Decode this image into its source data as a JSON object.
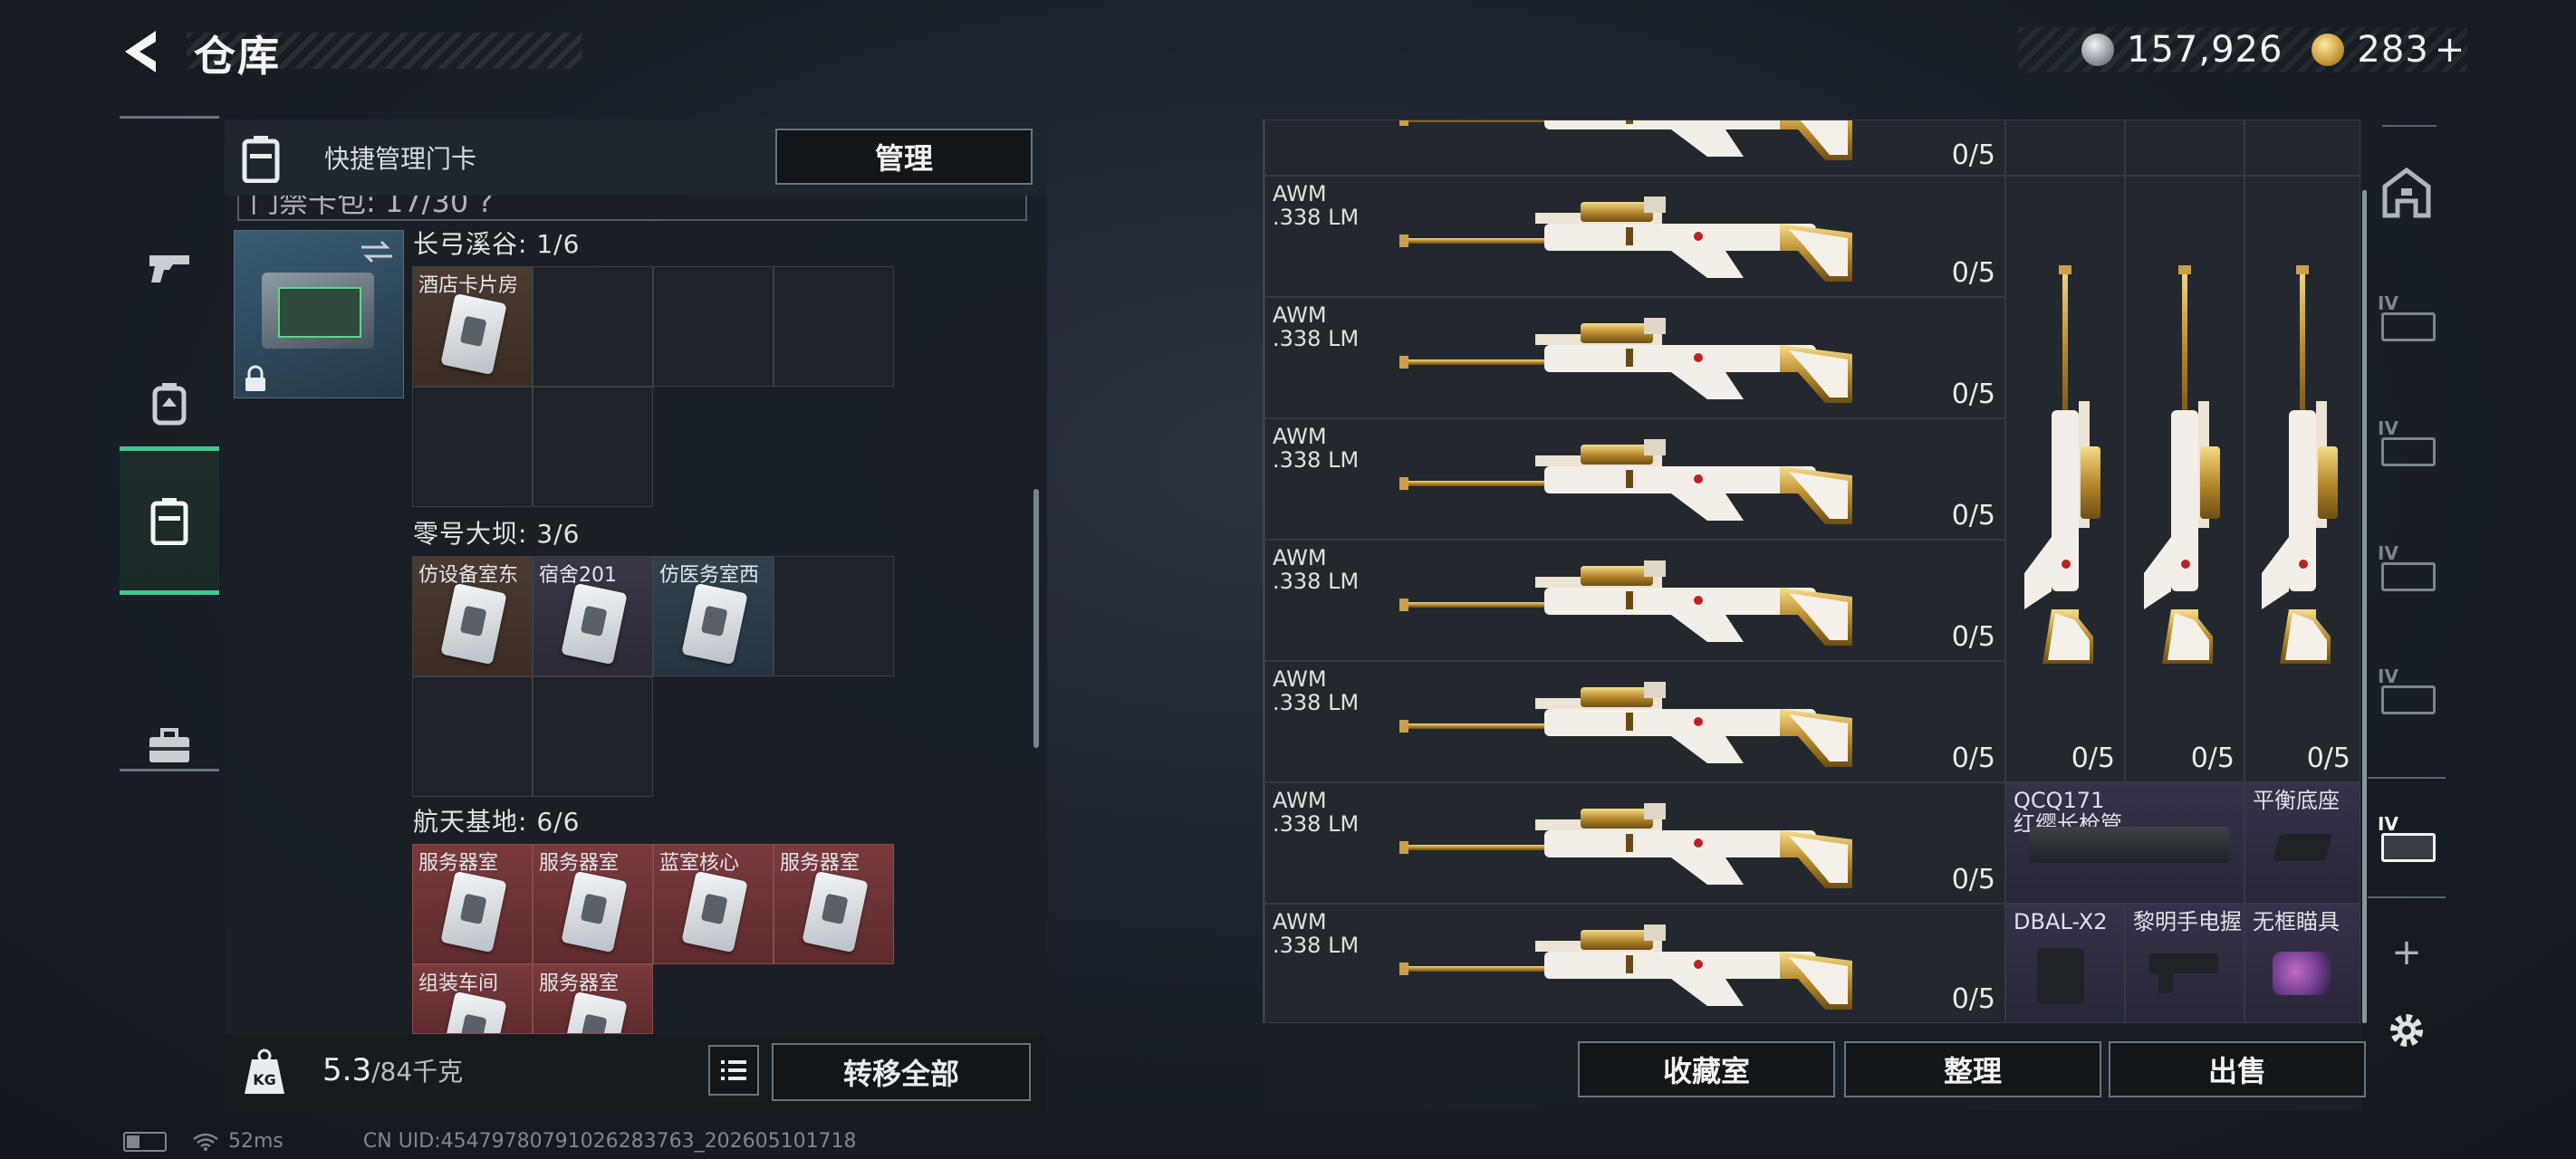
{
  "header": {
    "title": "仓库",
    "currency_silver": "157,926",
    "currency_gold": "283",
    "plus_label": "+"
  },
  "colors": {
    "accent": "#43c78e",
    "panel": "#1a1f26",
    "red_cell": "#7a3a3d"
  },
  "left_nav": {
    "items": [
      {
        "icon": "pistol-icon"
      },
      {
        "icon": "backpack-icon"
      },
      {
        "icon": "keycard-case-icon",
        "active": true
      },
      {
        "icon": "toolbox-icon"
      }
    ]
  },
  "left_panel": {
    "quick_label": "快捷管理门卡",
    "manage_button": "管理",
    "subheader_text": "门禁卡包: 17/30 ?",
    "sections": [
      {
        "title": "长弓溪谷: 1/6",
        "cards": [
          "酒店卡片房"
        ]
      },
      {
        "title": "零号大坝: 3/6",
        "cards": [
          "仿设备室东",
          "宿舍201",
          "仿医务室西"
        ]
      },
      {
        "title": "航天基地: 6/6",
        "cards": [
          "服务器室",
          "服务器室",
          "蓝室核心",
          "服务器室",
          "组装车间",
          "服务器室"
        ]
      }
    ],
    "weight_value": "5.3",
    "weight_max": "/84千克",
    "weight_icon_label": "KG",
    "transfer_all_button": "转移全部"
  },
  "right_panel": {
    "weapon_name": "AWM",
    "weapon_caliber": ".338 LM",
    "rows_count_label": "0/5",
    "awm_rows": 7,
    "vertical_counts": [
      "0/5",
      "0/5",
      "0/5"
    ],
    "attachments": [
      {
        "name": "QCQ171\n红缨长枪管"
      },
      {
        "name": "平衡底座"
      },
      {
        "name": "DBAL-X2"
      },
      {
        "name": "黎明手电握"
      },
      {
        "name": "无框瞄具"
      }
    ],
    "buttons": [
      "收藏室",
      "整理",
      "出售"
    ]
  },
  "right_nav": {
    "items": [
      "vault-icon",
      "tier4-case-1-icon",
      "tier4-case-2-icon",
      "tier4-case-3-icon",
      "tier4-case-4-icon",
      "tier4-case-5-icon",
      "add-icon",
      "settings-icon"
    ],
    "tier_label": "IV",
    "add_label": "+"
  },
  "footer": {
    "ping": "52ms",
    "uid": "CN UID:4547978079102628376​3_202605101718"
  }
}
